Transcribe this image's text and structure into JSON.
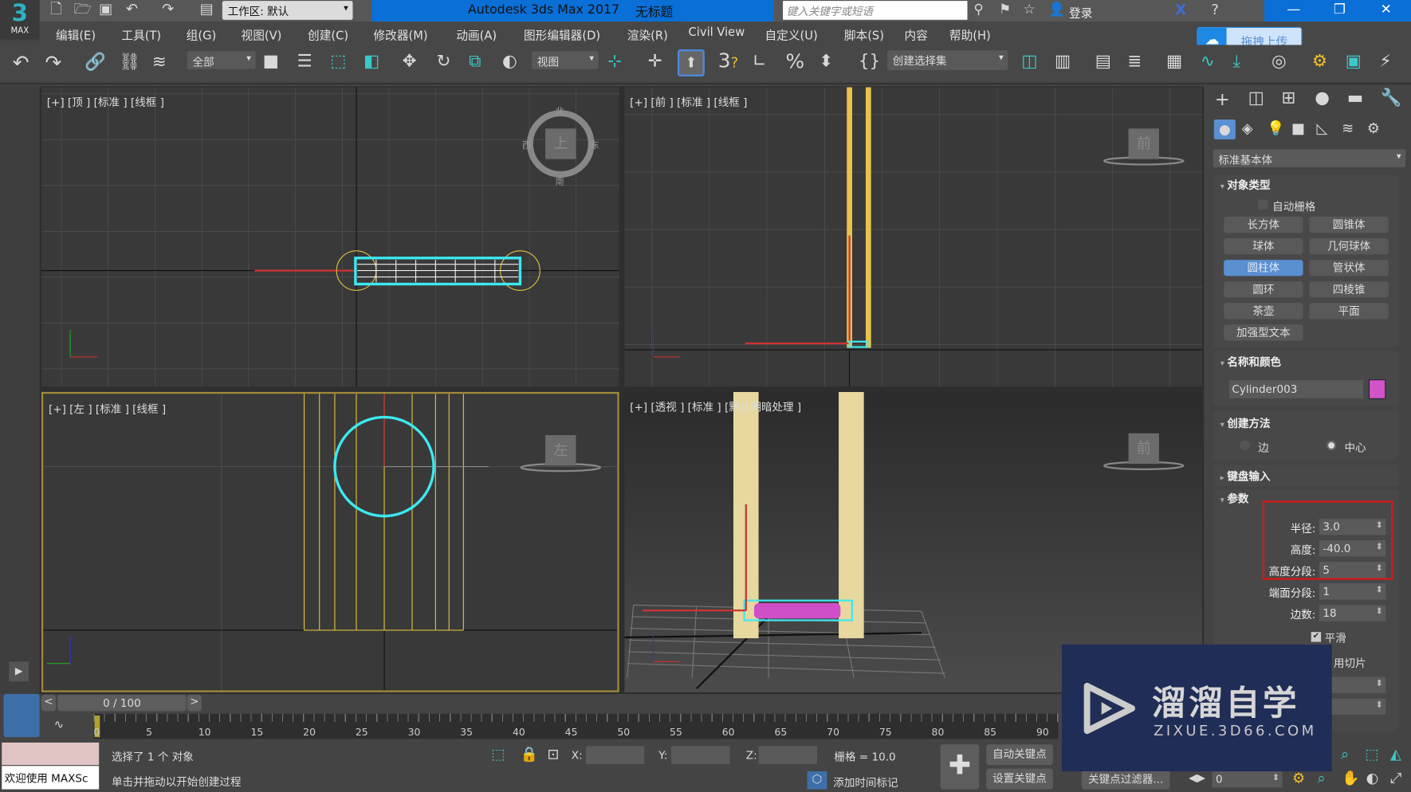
{
  "title_bar": {
    "logo": "3",
    "logo_sub": "MAX",
    "workspace": "工作区: 默认",
    "title": "Autodesk 3ds Max 2017",
    "document": "无标题",
    "search_placeholder": "键入关键字或短语",
    "login": "登录"
  },
  "menu": [
    "编辑(E)",
    "工具(T)",
    "组(G)",
    "视图(V)",
    "创建(C)",
    "修改器(M)",
    "动画(A)",
    "图形编辑器(D)",
    "渲染(R)",
    "Civil View",
    "自定义(U)",
    "脚本(S)",
    "内容",
    "帮助(H)"
  ],
  "upload_popup": "拖拽上传",
  "toolbar": {
    "selection_filter": "全部",
    "ref_coord": "视图",
    "named_selection": "创建选择集",
    "snap_3d": "3"
  },
  "viewports": {
    "top": {
      "label": "[+] [顶 ] [标准 ] [线框 ]",
      "cube": "上",
      "north": "北",
      "south": "南",
      "east": "东",
      "west": "西"
    },
    "front": {
      "label": "[+] [前 ] [标准 ] [线框 ]",
      "cube": "前"
    },
    "left": {
      "label": "[+] [左 ] [标准 ] [线框 ]",
      "cube": "左"
    },
    "perspective": {
      "label": "[+] [透视 ] [标准 ] [默认明暗处理 ]",
      "cube": "前"
    }
  },
  "command_panel": {
    "category": "标准基本体",
    "object_type": {
      "title": "对象类型",
      "autogrid": "自动栅格",
      "buttons": [
        "长方体",
        "圆锥体",
        "球体",
        "几何球体",
        "圆柱体",
        "管状体",
        "圆环",
        "四棱锥",
        "茶壶",
        "平面",
        "加强型文本"
      ],
      "active": "圆柱体"
    },
    "name_color": {
      "title": "名称和颜色",
      "name": "Cylinder003",
      "color": "#d155c8"
    },
    "creation_method": {
      "title": "创建方法",
      "edge": "边",
      "center": "中心",
      "selected": "中心"
    },
    "keyboard_entry": {
      "title": "键盘输入"
    },
    "parameters": {
      "title": "参数",
      "radius_label": "半径:",
      "radius": "3.0",
      "height_label": "高度:",
      "height": "-40.0",
      "height_segs_label": "高度分段:",
      "height_segs": "5",
      "cap_segs_label": "端面分段:",
      "cap_segs": "1",
      "sides_label": "边数:",
      "sides": "18",
      "smooth": "平滑",
      "smooth_checked": true,
      "slice": "用切片",
      "slice_from": "0",
      "slice_to": "0"
    }
  },
  "timeline": {
    "frame": "0 / 100",
    "prev": "<",
    "next": ">",
    "ticks": [
      "0",
      "5",
      "10",
      "15",
      "20",
      "25",
      "30",
      "35",
      "40",
      "45",
      "50",
      "55",
      "60",
      "65",
      "70",
      "75",
      "80",
      "85",
      "90"
    ]
  },
  "status": {
    "welcome": "欢迎使用 MAXSc",
    "selected": "选择了 1 个 对象",
    "prompt": "单击并拖动以开始创建过程",
    "x_label": "X:",
    "y_label": "Y:",
    "z_label": "Z:",
    "grid": "栅格 = 10.0",
    "add_time_tag": "添加时间标记",
    "auto_key": "自动关键点",
    "set_key": "设置关键点",
    "key_filters": "关键点过滤器...",
    "current_frame": "0"
  },
  "watermark": {
    "name": "溜溜自学",
    "url": "ZIXUE.3D66.COM"
  },
  "colors": {
    "title_blue": "#0a6fd6",
    "selection_cyan": "#3de8f0",
    "object_yellow": "#e8c24a",
    "active_button": "#5a8fd0"
  }
}
